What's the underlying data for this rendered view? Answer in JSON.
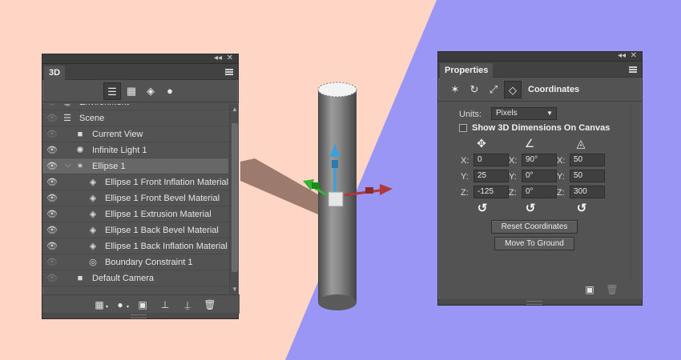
{
  "colors": {
    "bg_left": "#ffd6c6",
    "bg_right": "#9a96f6",
    "panel": "#535353",
    "axis_x": "#b03838",
    "axis_y": "#37a0e0",
    "axis_z": "#36b236"
  },
  "panel3d": {
    "tab_label": "3D",
    "tool_icons": [
      "scene-filter-icon",
      "mesh-filter-icon",
      "material-filter-icon",
      "light-filter-icon"
    ],
    "rows": [
      {
        "label": "Environment",
        "icon": "environment-icon",
        "eye": "dim"
      },
      {
        "label": "Scene",
        "icon": "scene-icon",
        "eye": "dim"
      },
      {
        "label": "Current View",
        "icon": "camera-icon",
        "eye": "dim"
      },
      {
        "label": "Infinite Light 1",
        "icon": "light-icon",
        "eye": "on"
      },
      {
        "label": "Ellipse 1",
        "icon": "mesh-icon",
        "eye": "on",
        "selected": true,
        "expanded": true
      },
      {
        "label": "Ellipse 1 Front Inflation Material",
        "icon": "material-icon",
        "eye": "on"
      },
      {
        "label": "Ellipse 1 Front Bevel Material",
        "icon": "material-icon",
        "eye": "on"
      },
      {
        "label": "Ellipse 1 Extrusion Material",
        "icon": "material-icon",
        "eye": "on"
      },
      {
        "label": "Ellipse 1 Back Bevel Material",
        "icon": "material-icon",
        "eye": "on"
      },
      {
        "label": "Ellipse 1 Back Inflation Material",
        "icon": "material-icon",
        "eye": "on"
      },
      {
        "label": "Boundary Constraint 1",
        "icon": "constraint-icon",
        "eye": "dim"
      },
      {
        "label": "Default Camera",
        "icon": "camera-icon",
        "eye": "dim"
      }
    ]
  },
  "props": {
    "tab_label": "Properties",
    "section_title": "Coordinates",
    "units_label": "Units:",
    "units_value": "Pixels",
    "show_dims_label": "Show 3D Dimensions On Canvas",
    "position": {
      "x": "0",
      "y": "25",
      "z": "-125"
    },
    "rotation": {
      "x": "90°",
      "y": "0°",
      "z": "0°"
    },
    "scale": {
      "x": "50",
      "y": "50",
      "z": "300"
    },
    "axis_labels": {
      "x": "X:",
      "y": "Y:",
      "z": "Z:"
    },
    "reset_label": "Reset Coordinates",
    "ground_label": "Move To Ground"
  }
}
